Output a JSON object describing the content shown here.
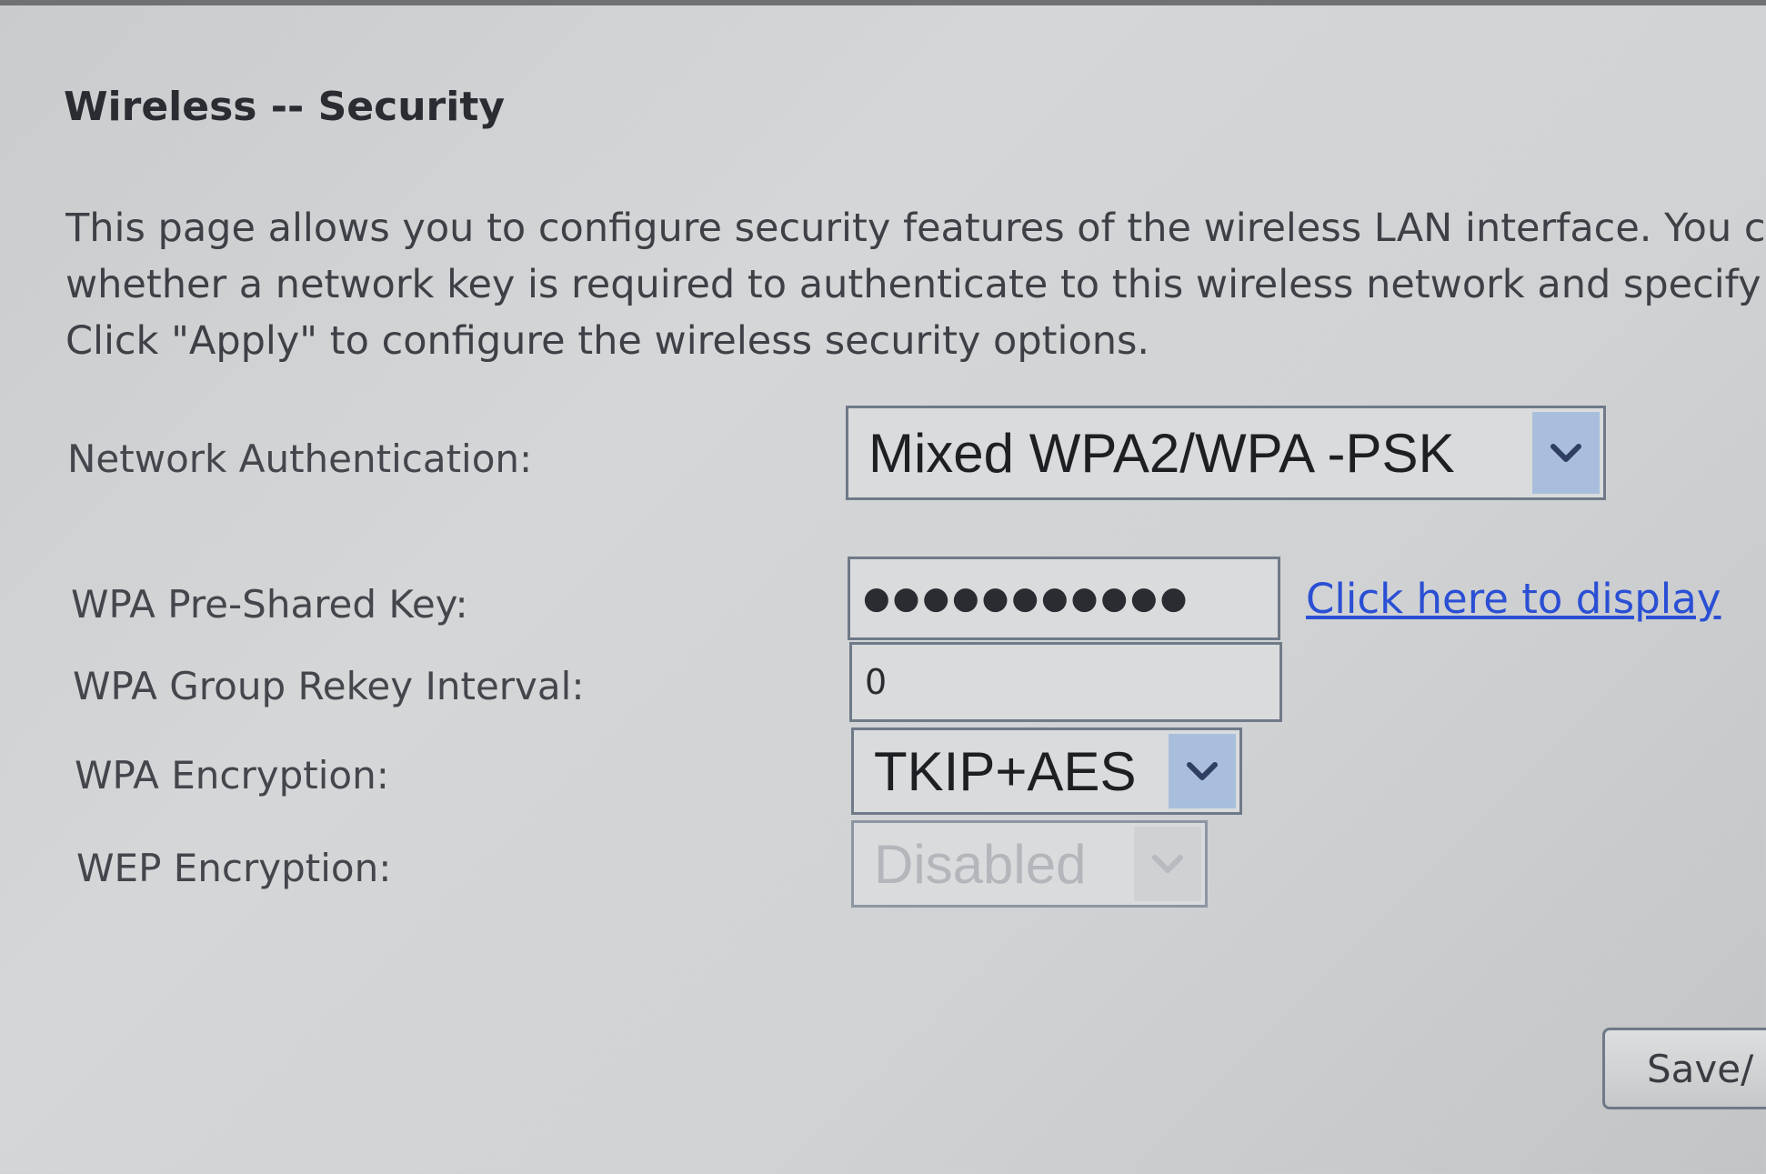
{
  "page": {
    "title": "Wireless -- Security",
    "description": [
      "This page allows you to configure security features of the wireless LAN interface. You c",
      "whether a network key is required to authenticate to this wireless network and specify",
      "Click \"Apply\" to configure the wireless security options."
    ]
  },
  "form": {
    "network_auth": {
      "label": "Network Authentication:",
      "value": "Mixed WPA2/WPA -PSK"
    },
    "psk": {
      "label": "WPA Pre-Shared Key:",
      "value": "●●●●●●●●●●●",
      "link": "Click here to display"
    },
    "rekey": {
      "label": "WPA Group Rekey Interval:",
      "value": "0"
    },
    "wpa_encryption": {
      "label": "WPA Encryption:",
      "value": "TKIP+AES"
    },
    "wep_encryption": {
      "label": "WEP Encryption:",
      "value": "Disabled"
    }
  },
  "buttons": {
    "save": "Save/"
  },
  "colors": {
    "background": "#d0d2d4",
    "link": "#2a4fd4",
    "select_arrow": "#a9bedc",
    "border": "#6f7a88"
  },
  "icons": {
    "dropdown": "chevron-down-icon"
  }
}
